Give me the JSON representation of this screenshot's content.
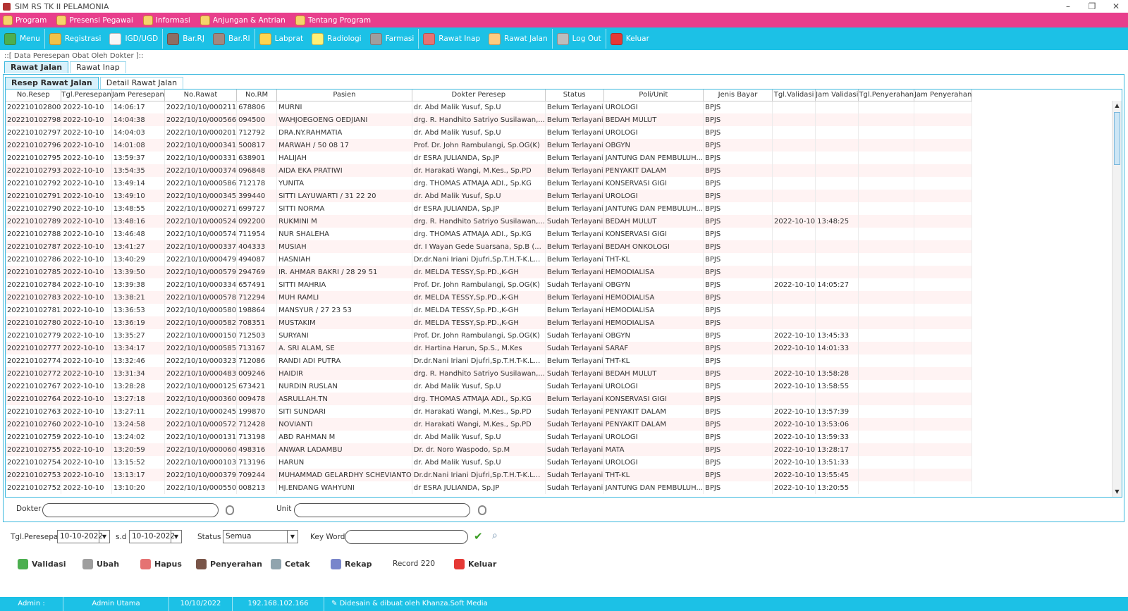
{
  "window": {
    "title": "SIM RS TK II PELAMONIA"
  },
  "menu": [
    {
      "label": "Program",
      "icon": "key-icon"
    },
    {
      "label": "Presensi Pegawai",
      "icon": "user-icon"
    },
    {
      "label": "Informasi",
      "icon": "info-icon"
    },
    {
      "label": "Anjungan & Antrian",
      "icon": "people-icon"
    },
    {
      "label": "Tentang Program",
      "icon": "document-icon"
    }
  ],
  "toolbar": [
    {
      "label": "Menu",
      "color": "#4caf50"
    },
    {
      "label": "Registrasi",
      "color": "#f0c24a"
    },
    {
      "label": "IGD/UGD",
      "color": "#f7f7f7"
    },
    {
      "label": "Bar.RJ",
      "color": "#8d6e63"
    },
    {
      "label": "Bar.RI",
      "color": "#a1887f"
    },
    {
      "label": "Labprat",
      "color": "#ffd54f"
    },
    {
      "label": "Radiologi",
      "color": "#fff176"
    },
    {
      "label": "Farmasi",
      "color": "#9e9e9e"
    },
    {
      "label": "Rawat Inap",
      "color": "#e57373"
    },
    {
      "label": "Rawat Jalan",
      "color": "#ffcc80"
    },
    {
      "label": "Log Out",
      "color": "#bdbdbd"
    },
    {
      "label": "Keluar",
      "color": "#e53935"
    }
  ],
  "panel_title": "::[ Data Peresepan Obat Oleh Dokter ]::",
  "outer_tabs": [
    "Rawat Jalan",
    "Rawat Inap"
  ],
  "inner_tabs": [
    "Resep Rawat Jalan",
    "Detail Rawat Jalan"
  ],
  "columns": [
    "No.Resep",
    "Tgl.Peresepan",
    "Jam Peresepan",
    "No.Rawat",
    "No.RM",
    "Pasien",
    "Dokter Peresep",
    "Status",
    "Poli/Unit",
    "Jenis Bayar",
    "Tgl.Validasi",
    "Jam Validasi",
    "Tgl.Penyerahan",
    "Jam Penyerahan"
  ],
  "rows": [
    [
      "202210102800",
      "2022-10-10",
      "14:06:17",
      "2022/10/10/000211",
      "678806",
      "MURNI",
      "dr. Abd Malik Yusuf, Sp.U",
      "Belum Terlayani",
      "UROLOGI",
      "BPJS",
      "",
      "",
      "",
      ""
    ],
    [
      "202210102798",
      "2022-10-10",
      "14:04:38",
      "2022/10/10/000566",
      "094500",
      "WAHJOEGOENG OEDJIANI",
      "drg. R. Handhito Satriyo Susilawan,...",
      "Belum Terlayani",
      "BEDAH MULUT",
      "BPJS",
      "",
      "",
      "",
      ""
    ],
    [
      "202210102797",
      "2022-10-10",
      "14:04:03",
      "2022/10/10/000201",
      "712792",
      "DRA.NY.RAHMATIA",
      "dr. Abd Malik Yusuf, Sp.U",
      "Belum Terlayani",
      "UROLOGI",
      "BPJS",
      "",
      "",
      "",
      ""
    ],
    [
      "202210102796",
      "2022-10-10",
      "14:01:08",
      "2022/10/10/000341",
      "500817",
      "MARWAH / 50 08 17",
      "Prof. Dr. John Rambulangi, Sp.OG(K)",
      "Belum Terlayani",
      "OBGYN",
      "BPJS",
      "",
      "",
      "",
      ""
    ],
    [
      "202210102795",
      "2022-10-10",
      "13:59:37",
      "2022/10/10/000331",
      "638901",
      "HALIJAH",
      "dr ESRA JULIANDA, Sp.JP",
      "Belum Terlayani",
      "JANTUNG DAN PEMBULUH...",
      "BPJS",
      "",
      "",
      "",
      ""
    ],
    [
      "202210102793",
      "2022-10-10",
      "13:54:35",
      "2022/10/10/000374",
      "096848",
      "AIDA EKA PRATIWI",
      "dr. Harakati Wangi, M.Kes., Sp.PD",
      "Belum Terlayani",
      "PENYAKIT DALAM",
      "BPJS",
      "",
      "",
      "",
      ""
    ],
    [
      "202210102792",
      "2022-10-10",
      "13:49:14",
      "2022/10/10/000586",
      "712178",
      "YUNITA",
      "drg. THOMAS ATMAJA ADI., Sp.KG",
      "Belum Terlayani",
      "KONSERVASI GIGI",
      "BPJS",
      "",
      "",
      "",
      ""
    ],
    [
      "202210102791",
      "2022-10-10",
      "13:49:10",
      "2022/10/10/000345",
      "399440",
      "SITTI LAYUWARTI / 31 22 20",
      "dr. Abd Malik Yusuf, Sp.U",
      "Belum Terlayani",
      "UROLOGI",
      "BPJS",
      "",
      "",
      "",
      ""
    ],
    [
      "202210102790",
      "2022-10-10",
      "13:48:55",
      "2022/10/10/000271",
      "699727",
      "SITTI NORMA",
      "dr ESRA JULIANDA, Sp.JP",
      "Belum Terlayani",
      "JANTUNG DAN PEMBULUH...",
      "BPJS",
      "",
      "",
      "",
      ""
    ],
    [
      "202210102789",
      "2022-10-10",
      "13:48:16",
      "2022/10/10/000524",
      "092200",
      "RUKMINI M",
      "drg. R. Handhito Satriyo Susilawan,...",
      "Sudah Terlayani",
      "BEDAH MULUT",
      "BPJS",
      "2022-10-10",
      "13:48:25",
      "",
      ""
    ],
    [
      "202210102788",
      "2022-10-10",
      "13:46:48",
      "2022/10/10/000574",
      "711954",
      "NUR SHALEHA",
      "drg. THOMAS ATMAJA ADI., Sp.KG",
      "Belum Terlayani",
      "KONSERVASI GIGI",
      "BPJS",
      "",
      "",
      "",
      ""
    ],
    [
      "202210102787",
      "2022-10-10",
      "13:41:27",
      "2022/10/10/000337",
      "404333",
      "MUSIAH",
      "dr. I Wayan Gede Suarsana, Sp.B (...",
      "Belum Terlayani",
      "BEDAH ONKOLOGI",
      "BPJS",
      "",
      "",
      "",
      ""
    ],
    [
      "202210102786",
      "2022-10-10",
      "13:40:29",
      "2022/10/10/000479",
      "494087",
      "HASNIAH",
      "Dr.dr.Nani Iriani Djufri,Sp.T.H.T-K.L...",
      "Belum Terlayani",
      "THT-KL",
      "BPJS",
      "",
      "",
      "",
      ""
    ],
    [
      "202210102785",
      "2022-10-10",
      "13:39:50",
      "2022/10/10/000579",
      "294769",
      "IR. AHMAR BAKRI / 28 29 51",
      "dr. MELDA TESSY,Sp.PD.,K-GH",
      "Belum Terlayani",
      "HEMODIALISA",
      "BPJS",
      "",
      "",
      "",
      ""
    ],
    [
      "202210102784",
      "2022-10-10",
      "13:39:38",
      "2022/10/10/000334",
      "657491",
      "SITTI MAHRIA",
      "Prof. Dr. John Rambulangi, Sp.OG(K)",
      "Sudah Terlayani",
      "OBGYN",
      "BPJS",
      "2022-10-10",
      "14:05:27",
      "",
      ""
    ],
    [
      "202210102783",
      "2022-10-10",
      "13:38:21",
      "2022/10/10/000578",
      "712294",
      "MUH RAMLI",
      "dr. MELDA TESSY,Sp.PD.,K-GH",
      "Belum Terlayani",
      "HEMODIALISA",
      "BPJS",
      "",
      "",
      "",
      ""
    ],
    [
      "202210102781",
      "2022-10-10",
      "13:36:53",
      "2022/10/10/000580",
      "198864",
      "MANSYUR / 27 23 53",
      "dr. MELDA TESSY,Sp.PD.,K-GH",
      "Belum Terlayani",
      "HEMODIALISA",
      "BPJS",
      "",
      "",
      "",
      ""
    ],
    [
      "202210102780",
      "2022-10-10",
      "13:36:19",
      "2022/10/10/000582",
      "708351",
      "MUSTAKIM",
      "dr. MELDA TESSY,Sp.PD.,K-GH",
      "Belum Terlayani",
      "HEMODIALISA",
      "BPJS",
      "",
      "",
      "",
      ""
    ],
    [
      "202210102779",
      "2022-10-10",
      "13:35:27",
      "2022/10/10/000150",
      "712503",
      "SURYANI",
      "Prof. Dr. John Rambulangi, Sp.OG(K)",
      "Sudah Terlayani",
      "OBGYN",
      "BPJS",
      "2022-10-10",
      "13:45:33",
      "",
      ""
    ],
    [
      "202210102777",
      "2022-10-10",
      "13:34:17",
      "2022/10/10/000585",
      "713167",
      "A. SRI ALAM, SE",
      "dr. Hartina Harun, Sp.S., M.Kes",
      "Sudah Terlayani",
      "SARAF",
      "BPJS",
      "2022-10-10",
      "14:01:33",
      "",
      ""
    ],
    [
      "202210102774",
      "2022-10-10",
      "13:32:46",
      "2022/10/10/000323",
      "712086",
      "RANDI ADI PUTRA",
      "Dr.dr.Nani Iriani Djufri,Sp.T.H.T-K.L...",
      "Belum Terlayani",
      "THT-KL",
      "BPJS",
      "",
      "",
      "",
      ""
    ],
    [
      "202210102772",
      "2022-10-10",
      "13:31:34",
      "2022/10/10/000483",
      "009246",
      "HAIDIR",
      "drg. R. Handhito Satriyo Susilawan,...",
      "Sudah Terlayani",
      "BEDAH MULUT",
      "BPJS",
      "2022-10-10",
      "13:58:28",
      "",
      ""
    ],
    [
      "202210102767",
      "2022-10-10",
      "13:28:28",
      "2022/10/10/000125",
      "673421",
      "NURDIN RUSLAN",
      "dr. Abd Malik Yusuf, Sp.U",
      "Sudah Terlayani",
      "UROLOGI",
      "BPJS",
      "2022-10-10",
      "13:58:55",
      "",
      ""
    ],
    [
      "202210102764",
      "2022-10-10",
      "13:27:18",
      "2022/10/10/000360",
      "009478",
      "ASRULLAH.TN",
      "drg. THOMAS ATMAJA ADI., Sp.KG",
      "Belum Terlayani",
      "KONSERVASI GIGI",
      "BPJS",
      "",
      "",
      "",
      ""
    ],
    [
      "202210102763",
      "2022-10-10",
      "13:27:11",
      "2022/10/10/000245",
      "199870",
      "SITI SUNDARI",
      "dr. Harakati Wangi, M.Kes., Sp.PD",
      "Sudah Terlayani",
      "PENYAKIT DALAM",
      "BPJS",
      "2022-10-10",
      "13:57:39",
      "",
      ""
    ],
    [
      "202210102760",
      "2022-10-10",
      "13:24:58",
      "2022/10/10/000572",
      "712428",
      "NOVIANTI",
      "dr. Harakati Wangi, M.Kes., Sp.PD",
      "Sudah Terlayani",
      "PENYAKIT DALAM",
      "BPJS",
      "2022-10-10",
      "13:53:06",
      "",
      ""
    ],
    [
      "202210102759",
      "2022-10-10",
      "13:24:02",
      "2022/10/10/000131",
      "713198",
      "ABD RAHMAN M",
      "dr. Abd Malik Yusuf, Sp.U",
      "Sudah Terlayani",
      "UROLOGI",
      "BPJS",
      "2022-10-10",
      "13:59:33",
      "",
      ""
    ],
    [
      "202210102755",
      "2022-10-10",
      "13:20:59",
      "2022/10/10/000060",
      "498316",
      "ANWAR LADAMBU",
      "Dr. dr. Noro Waspodo, Sp.M",
      "Sudah Terlayani",
      "MATA",
      "BPJS",
      "2022-10-10",
      "13:28:17",
      "",
      ""
    ],
    [
      "202210102754",
      "2022-10-10",
      "13:15:52",
      "2022/10/10/000103",
      "713196",
      "HARUN",
      "dr. Abd Malik Yusuf, Sp.U",
      "Sudah Terlayani",
      "UROLOGI",
      "BPJS",
      "2022-10-10",
      "13:51:33",
      "",
      ""
    ],
    [
      "202210102753",
      "2022-10-10",
      "13:13:17",
      "2022/10/10/000379",
      "709244",
      "MUHAMMAD GELARDHY SCHEVIANTO",
      "Dr.dr.Nani Iriani Djufri,Sp.T.H.T-K.L...",
      "Sudah Terlayani",
      "THT-KL",
      "BPJS",
      "2022-10-10",
      "13:55:45",
      "",
      ""
    ],
    [
      "202210102752",
      "2022-10-10",
      "13:10:20",
      "2022/10/10/000550",
      "008213",
      "HJ.ENDANG WAHYUNI",
      "dr ESRA JULIANDA, Sp.JP",
      "Sudah Terlayani",
      "JANTUNG DAN PEMBULUH...",
      "BPJS",
      "2022-10-10",
      "13:20:55",
      "",
      ""
    ]
  ],
  "filters": {
    "dokter_label": "Dokter :",
    "dokter_value": "",
    "unit_label": "Unit :",
    "unit_value": "",
    "tgl_label": "Tgl.Peresepan :",
    "tgl_from": "10-10-2022",
    "sd_label": "s.d",
    "tgl_to": "10-10-2022",
    "status_label": "Status :",
    "status_value": "Semua",
    "keyword_label": "Key Word :",
    "keyword_value": ""
  },
  "actions": [
    {
      "label": "Validasi",
      "color": "#4caf50"
    },
    {
      "label": "Ubah",
      "color": "#9e9e9e"
    },
    {
      "label": "Hapus",
      "color": "#e57373"
    },
    {
      "label": "Penyerahan",
      "color": "#795548"
    },
    {
      "label": "Cetak",
      "color": "#90a4ae"
    },
    {
      "label": "Rekap",
      "color": "#7986cb"
    },
    {
      "label": "Keluar",
      "color": "#e53935"
    }
  ],
  "record_label": "Record :",
  "record_count": "220",
  "statusbar": {
    "admin_label": "Admin :",
    "admin_name": "Admin Utama",
    "date": "10/10/2022",
    "ip": "192.168.102.166",
    "credit": "Didesain & dibuat oleh Khanza.Soft Media"
  }
}
